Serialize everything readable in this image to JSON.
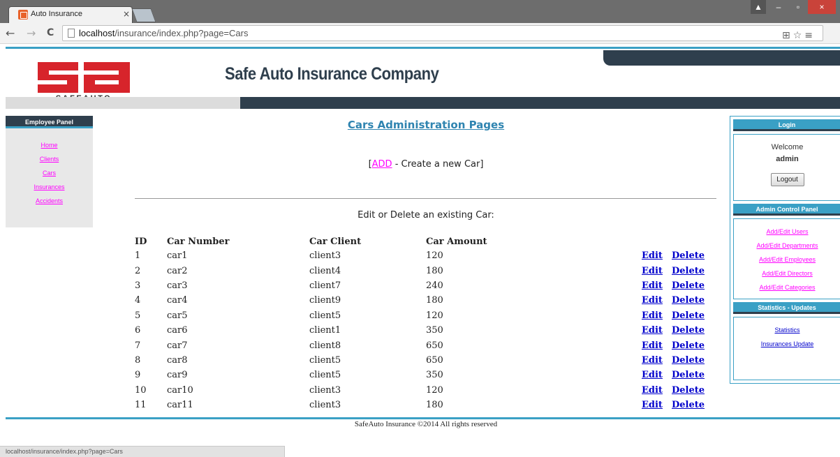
{
  "browser": {
    "tab_title": "Auto Insurance",
    "tab_close": "×",
    "url_host": "localhost",
    "url_path": "/insurance/index.php?page=Cars",
    "status_url": "localhost/insurance/index.php?page=Cars",
    "win_user": "▲",
    "win_min": "–",
    "win_max": "▫",
    "win_close": "×",
    "back": "←",
    "forward": "→",
    "reload": "C",
    "addr_icons": "⊞☆≡"
  },
  "header": {
    "title": "Safe Auto Insurance Company",
    "logo_text": "SAFEAUTO"
  },
  "employee_panel": {
    "title": "Employee Panel",
    "links": [
      "Home",
      "Clients",
      "Cars",
      "Insurances",
      "Accidents"
    ]
  },
  "main": {
    "title": "Cars Administration Pages",
    "add_open": "[",
    "add_link": "ADD",
    "add_rest": " - Create a new Car]",
    "edit_line": "Edit or Delete an existing Car:",
    "columns": [
      "ID",
      "Car Number",
      "Car Client",
      "Car Amount"
    ],
    "edit_label": "Edit",
    "delete_label": "Delete",
    "rows": [
      {
        "id": "1",
        "number": "car1",
        "client": "client3",
        "amount": "120"
      },
      {
        "id": "2",
        "number": "car2",
        "client": "client4",
        "amount": "180"
      },
      {
        "id": "3",
        "number": "car3",
        "client": "client7",
        "amount": "240"
      },
      {
        "id": "4",
        "number": "car4",
        "client": "client9",
        "amount": "180"
      },
      {
        "id": "5",
        "number": "car5",
        "client": "client5",
        "amount": "120"
      },
      {
        "id": "6",
        "number": "car6",
        "client": "client1",
        "amount": "350"
      },
      {
        "id": "7",
        "number": "car7",
        "client": "client8",
        "amount": "650"
      },
      {
        "id": "8",
        "number": "car8",
        "client": "client5",
        "amount": "650"
      },
      {
        "id": "9",
        "number": "car9",
        "client": "client5",
        "amount": "350"
      },
      {
        "id": "10",
        "number": "car10",
        "client": "client3",
        "amount": "120"
      },
      {
        "id": "11",
        "number": "car11",
        "client": "client3",
        "amount": "180"
      }
    ]
  },
  "login": {
    "title": "Login",
    "welcome": "Welcome",
    "user": "admin",
    "logout": "Logout"
  },
  "admin_panel": {
    "title": "Admin Control Panel",
    "links": [
      "Add/Edit Users",
      "Add/Edit Departments",
      "Add/Edit Employees",
      "Add/Edit Directors",
      "Add/Edit Categories"
    ]
  },
  "stats_panel": {
    "title": "Statistics - Updates",
    "links": [
      "Statistics",
      "Insurances Update"
    ]
  },
  "footer": {
    "text": "SafeAuto Insurance ©2014 All rights reserved"
  },
  "colors": {
    "accent": "#3aa0c5",
    "dark": "#2f3f4d",
    "link": "#ff00ff",
    "logo_red": "#d7242b"
  }
}
